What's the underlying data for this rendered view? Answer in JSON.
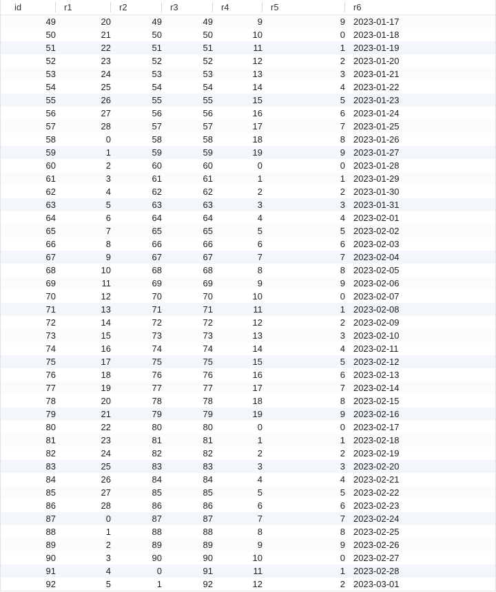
{
  "columns": [
    {
      "key": "idx",
      "label": ""
    },
    {
      "key": "id",
      "label": "id"
    },
    {
      "key": "r1",
      "label": "r1"
    },
    {
      "key": "r2",
      "label": "r2"
    },
    {
      "key": "r3",
      "label": "r3"
    },
    {
      "key": "r4",
      "label": "r4"
    },
    {
      "key": "r5",
      "label": "r5"
    },
    {
      "key": "r6",
      "label": "r6"
    }
  ],
  "rows": [
    {
      "id": 49,
      "r1": 20,
      "r2": 49,
      "r3": 49,
      "r4": 9,
      "r5": 9,
      "r6": "2023-01-17"
    },
    {
      "id": 50,
      "r1": 21,
      "r2": 50,
      "r3": 50,
      "r4": 10,
      "r5": 0,
      "r6": "2023-01-18"
    },
    {
      "id": 51,
      "r1": 22,
      "r2": 51,
      "r3": 51,
      "r4": 11,
      "r5": 1,
      "r6": "2023-01-19"
    },
    {
      "id": 52,
      "r1": 23,
      "r2": 52,
      "r3": 52,
      "r4": 12,
      "r5": 2,
      "r6": "2023-01-20"
    },
    {
      "id": 53,
      "r1": 24,
      "r2": 53,
      "r3": 53,
      "r4": 13,
      "r5": 3,
      "r6": "2023-01-21"
    },
    {
      "id": 54,
      "r1": 25,
      "r2": 54,
      "r3": 54,
      "r4": 14,
      "r5": 4,
      "r6": "2023-01-22"
    },
    {
      "id": 55,
      "r1": 26,
      "r2": 55,
      "r3": 55,
      "r4": 15,
      "r5": 5,
      "r6": "2023-01-23"
    },
    {
      "id": 56,
      "r1": 27,
      "r2": 56,
      "r3": 56,
      "r4": 16,
      "r5": 6,
      "r6": "2023-01-24"
    },
    {
      "id": 57,
      "r1": 28,
      "r2": 57,
      "r3": 57,
      "r4": 17,
      "r5": 7,
      "r6": "2023-01-25"
    },
    {
      "id": 58,
      "r1": 0,
      "r2": 58,
      "r3": 58,
      "r4": 18,
      "r5": 8,
      "r6": "2023-01-26"
    },
    {
      "id": 59,
      "r1": 1,
      "r2": 59,
      "r3": 59,
      "r4": 19,
      "r5": 9,
      "r6": "2023-01-27"
    },
    {
      "id": 60,
      "r1": 2,
      "r2": 60,
      "r3": 60,
      "r4": 0,
      "r5": 0,
      "r6": "2023-01-28"
    },
    {
      "id": 61,
      "r1": 3,
      "r2": 61,
      "r3": 61,
      "r4": 1,
      "r5": 1,
      "r6": "2023-01-29"
    },
    {
      "id": 62,
      "r1": 4,
      "r2": 62,
      "r3": 62,
      "r4": 2,
      "r5": 2,
      "r6": "2023-01-30"
    },
    {
      "id": 63,
      "r1": 5,
      "r2": 63,
      "r3": 63,
      "r4": 3,
      "r5": 3,
      "r6": "2023-01-31"
    },
    {
      "id": 64,
      "r1": 6,
      "r2": 64,
      "r3": 64,
      "r4": 4,
      "r5": 4,
      "r6": "2023-02-01"
    },
    {
      "id": 65,
      "r1": 7,
      "r2": 65,
      "r3": 65,
      "r4": 5,
      "r5": 5,
      "r6": "2023-02-02"
    },
    {
      "id": 66,
      "r1": 8,
      "r2": 66,
      "r3": 66,
      "r4": 6,
      "r5": 6,
      "r6": "2023-02-03"
    },
    {
      "id": 67,
      "r1": 9,
      "r2": 67,
      "r3": 67,
      "r4": 7,
      "r5": 7,
      "r6": "2023-02-04"
    },
    {
      "id": 68,
      "r1": 10,
      "r2": 68,
      "r3": 68,
      "r4": 8,
      "r5": 8,
      "r6": "2023-02-05"
    },
    {
      "id": 69,
      "r1": 11,
      "r2": 69,
      "r3": 69,
      "r4": 9,
      "r5": 9,
      "r6": "2023-02-06"
    },
    {
      "id": 70,
      "r1": 12,
      "r2": 70,
      "r3": 70,
      "r4": 10,
      "r5": 0,
      "r6": "2023-02-07"
    },
    {
      "id": 71,
      "r1": 13,
      "r2": 71,
      "r3": 71,
      "r4": 11,
      "r5": 1,
      "r6": "2023-02-08"
    },
    {
      "id": 72,
      "r1": 14,
      "r2": 72,
      "r3": 72,
      "r4": 12,
      "r5": 2,
      "r6": "2023-02-09"
    },
    {
      "id": 73,
      "r1": 15,
      "r2": 73,
      "r3": 73,
      "r4": 13,
      "r5": 3,
      "r6": "2023-02-10"
    },
    {
      "id": 74,
      "r1": 16,
      "r2": 74,
      "r3": 74,
      "r4": 14,
      "r5": 4,
      "r6": "2023-02-11"
    },
    {
      "id": 75,
      "r1": 17,
      "r2": 75,
      "r3": 75,
      "r4": 15,
      "r5": 5,
      "r6": "2023-02-12"
    },
    {
      "id": 76,
      "r1": 18,
      "r2": 76,
      "r3": 76,
      "r4": 16,
      "r5": 6,
      "r6": "2023-02-13"
    },
    {
      "id": 77,
      "r1": 19,
      "r2": 77,
      "r3": 77,
      "r4": 17,
      "r5": 7,
      "r6": "2023-02-14"
    },
    {
      "id": 78,
      "r1": 20,
      "r2": 78,
      "r3": 78,
      "r4": 18,
      "r5": 8,
      "r6": "2023-02-15"
    },
    {
      "id": 79,
      "r1": 21,
      "r2": 79,
      "r3": 79,
      "r4": 19,
      "r5": 9,
      "r6": "2023-02-16"
    },
    {
      "id": 80,
      "r1": 22,
      "r2": 80,
      "r3": 80,
      "r4": 0,
      "r5": 0,
      "r6": "2023-02-17"
    },
    {
      "id": 81,
      "r1": 23,
      "r2": 81,
      "r3": 81,
      "r4": 1,
      "r5": 1,
      "r6": "2023-02-18"
    },
    {
      "id": 82,
      "r1": 24,
      "r2": 82,
      "r3": 82,
      "r4": 2,
      "r5": 2,
      "r6": "2023-02-19"
    },
    {
      "id": 83,
      "r1": 25,
      "r2": 83,
      "r3": 83,
      "r4": 3,
      "r5": 3,
      "r6": "2023-02-20"
    },
    {
      "id": 84,
      "r1": 26,
      "r2": 84,
      "r3": 84,
      "r4": 4,
      "r5": 4,
      "r6": "2023-02-21"
    },
    {
      "id": 85,
      "r1": 27,
      "r2": 85,
      "r3": 85,
      "r4": 5,
      "r5": 5,
      "r6": "2023-02-22"
    },
    {
      "id": 86,
      "r1": 28,
      "r2": 86,
      "r3": 86,
      "r4": 6,
      "r5": 6,
      "r6": "2023-02-23"
    },
    {
      "id": 87,
      "r1": 0,
      "r2": 87,
      "r3": 87,
      "r4": 7,
      "r5": 7,
      "r6": "2023-02-24"
    },
    {
      "id": 88,
      "r1": 1,
      "r2": 88,
      "r3": 88,
      "r4": 8,
      "r5": 8,
      "r6": "2023-02-25"
    },
    {
      "id": 89,
      "r1": 2,
      "r2": 89,
      "r3": 89,
      "r4": 9,
      "r5": 9,
      "r6": "2023-02-26"
    },
    {
      "id": 90,
      "r1": 3,
      "r2": 90,
      "r3": 90,
      "r4": 10,
      "r5": 0,
      "r6": "2023-02-27"
    },
    {
      "id": 91,
      "r1": 4,
      "r2": 0,
      "r3": 91,
      "r4": 11,
      "r5": 1,
      "r6": "2023-02-28"
    },
    {
      "id": 92,
      "r1": 5,
      "r2": 1,
      "r3": 92,
      "r4": 12,
      "r5": 2,
      "r6": "2023-03-01"
    }
  ]
}
